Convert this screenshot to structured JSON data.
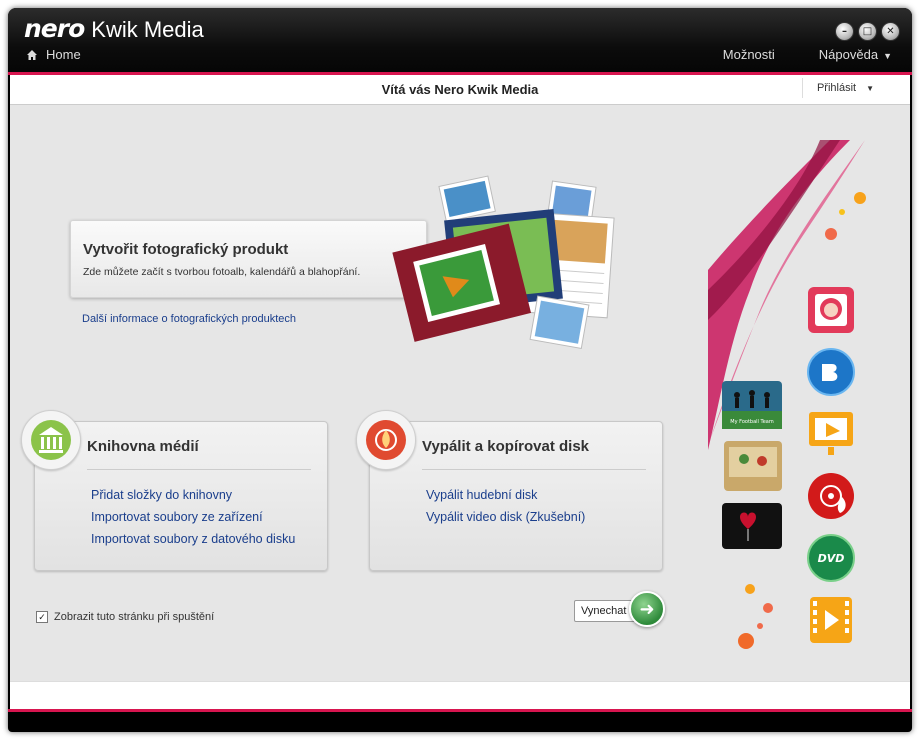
{
  "window": {
    "brand": "nero",
    "product": "Kwik Media",
    "home_label": "Home",
    "menu": {
      "options": "Možnosti",
      "help": "Nápověda"
    }
  },
  "welcome": {
    "title": "Vítá vás Nero Kwik Media",
    "login": "Přihlásit"
  },
  "photo_product": {
    "title": "Vytvořit fotografický produkt",
    "description": "Zde můžete začít s tvorbou fotoalb, kalendářů a blahopřání.",
    "more_link": "Další informace o fotografických produktech"
  },
  "media_library": {
    "title": "Knihovna médií",
    "links": [
      "Přidat složky do knihovny",
      "Importovat soubory ze zařízení",
      "Importovat soubory z datového disku"
    ]
  },
  "burn_copy": {
    "title": "Vypálit a kopírovat disk",
    "links": [
      "Vypálit hudební disk",
      "Vypálit video disk (Zkušební)"
    ]
  },
  "startup": {
    "label": "Zobrazit tuto stránku při spuštění",
    "checked": true
  },
  "skip_button": "Vynechat",
  "thumbnails": {
    "football": "My Football Team"
  },
  "colors": {
    "accent": "#d7154f",
    "link": "#1a3e8c"
  }
}
